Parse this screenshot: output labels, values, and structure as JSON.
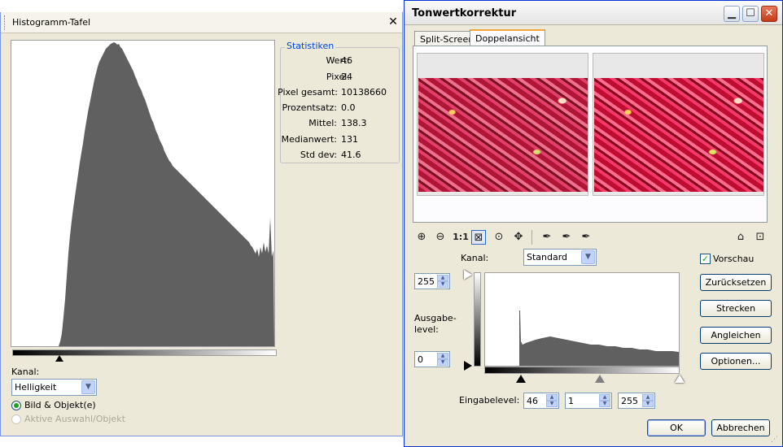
{
  "histogram_panel": {
    "title": "Histogramm-Tafel",
    "close": "✕",
    "stats_title": "Statistiken",
    "stats": [
      {
        "label": "Wert:",
        "value": "46"
      },
      {
        "label": "Pixel:",
        "value": "24"
      },
      {
        "label": "Pixel gesamt:",
        "value": "10138660"
      },
      {
        "label": "Prozentsatz:",
        "value": "0.0"
      },
      {
        "label": "Mittel:",
        "value": "138.3"
      },
      {
        "label": "Medianwert:",
        "value": "131"
      },
      {
        "label": "Std dev:",
        "value": "41.6"
      }
    ],
    "channel_label": "Kanal:",
    "channel_value": "Helligkeit",
    "radio_image": "Bild & Objekt(e)",
    "radio_selection": "Aktive Auswahl/Objekt",
    "colors": {
      "bars": "#606060"
    }
  },
  "levels_dialog": {
    "title": "Tonwertkorrektur",
    "tabs": [
      {
        "label": "Split-Screen"
      },
      {
        "label": "Doppelansicht"
      }
    ],
    "toolbar_icons": [
      "zoom-in-icon",
      "zoom-out-icon",
      "actual-size-icon",
      "fit-icon",
      "zoom-selection-icon",
      "pan-icon",
      "eyedropper-black-icon",
      "eyedropper-gray-icon",
      "eyedropper-white-icon"
    ],
    "zoom_1to1": "1:1",
    "channel_label": "Kanal:",
    "channel_value": "Standard",
    "preview_label": "Vorschau",
    "output_top": "255",
    "output_bottom": "0",
    "output_label": "Ausgabe-\nlevel:",
    "input_label": "Eingabelevel:",
    "input_low": "46",
    "input_gamma": "1",
    "input_high": "255",
    "buttons": {
      "reset": "Zurücksetzen",
      "stretch": "Strecken",
      "equalize": "Angleichen",
      "options": "Optionen...",
      "ok": "OK",
      "cancel": "Abbrechen"
    }
  }
}
